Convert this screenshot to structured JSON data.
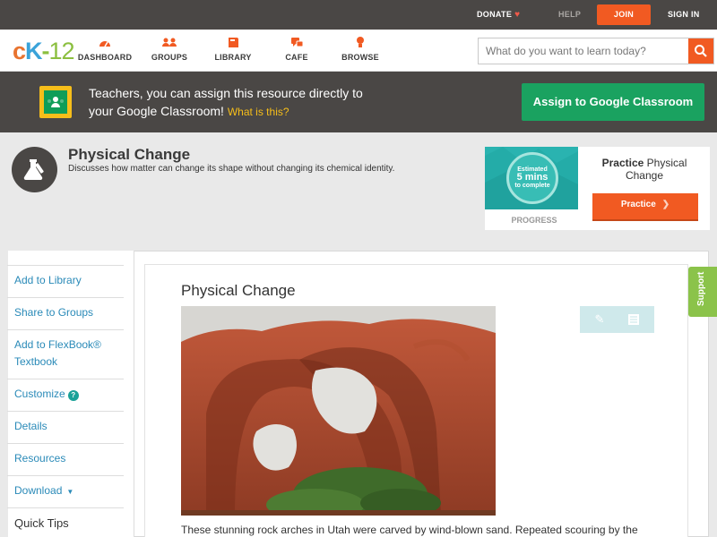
{
  "topbar": {
    "donate": "DONATE",
    "help": "HELP",
    "join": "JOIN",
    "signin": "SIGN IN"
  },
  "logo": {
    "c": "c",
    "k": "K",
    "dash": "-",
    "num": "12"
  },
  "nav": {
    "items": [
      {
        "label": "DASHBOARD",
        "icon": "dashboard-icon"
      },
      {
        "label": "GROUPS",
        "icon": "groups-icon"
      },
      {
        "label": "LIBRARY",
        "icon": "library-icon"
      },
      {
        "label": "CAFE",
        "icon": "cafe-icon"
      },
      {
        "label": "BROWSE",
        "icon": "browse-icon"
      }
    ]
  },
  "search": {
    "placeholder": "What do you want to learn today?"
  },
  "banner": {
    "line1": "Teachers, you can assign this resource directly to",
    "line2": "your Google Classroom!",
    "what": "What is this?",
    "assign": "Assign to Google Classroom"
  },
  "concept": {
    "title": "Physical Change",
    "description": "Discusses how matter can change its shape without changing its chemical identity."
  },
  "practice": {
    "estimated": "Estimated",
    "mins": "5 mins",
    "to_complete": "to complete",
    "progress": "PROGRESS",
    "title_bold": "Practice",
    "title_rest": "Physical Change",
    "button": "Practice"
  },
  "sidebar": {
    "items": [
      "Add to Library",
      "Share to Groups",
      "Add to FlexBook®",
      "Textbook",
      "Customize",
      "Details",
      "Resources",
      "Download"
    ],
    "help": "?",
    "quick_tips": "Quick Tips"
  },
  "article": {
    "title": "Physical Change",
    "caption": "These stunning rock arches in Utah were carved by wind-blown sand. Repeated scouring by the"
  },
  "support": "Support",
  "colors": {
    "accent": "#f15a22",
    "green": "#1aa260",
    "dark": "#4a4745",
    "link": "#2a8ab8"
  }
}
